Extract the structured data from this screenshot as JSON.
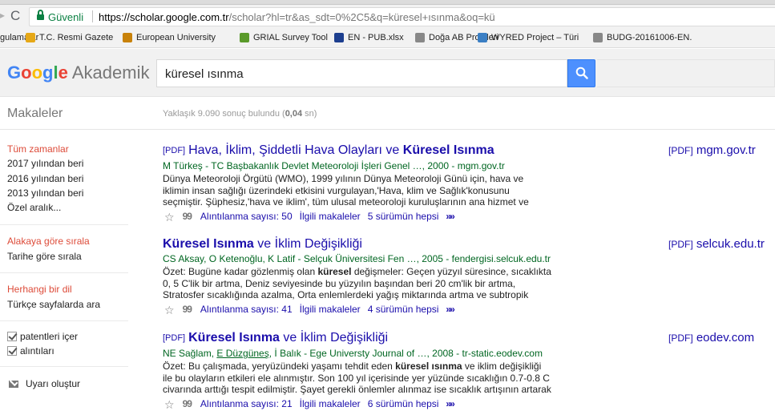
{
  "browser": {
    "reload_glyph": "C",
    "secure_label": "Güvenli",
    "url_host": "https://scholar.google.com.tr",
    "url_path": "/scholar?hl=tr&as_sdt=0%2C5&q=küresel+ısınma&oq=kü"
  },
  "bookmarks": [
    {
      "label": "gulamalar",
      "icon": "",
      "color": ""
    },
    {
      "label": "T.C. Resmi Gazete",
      "icon": "seal-icon",
      "color": "#e6a817"
    },
    {
      "label": "European University",
      "icon": "university-icon",
      "color": "#c8820a"
    },
    {
      "label": "GRIAL Survey Tool",
      "icon": "leaf-icon",
      "color": "#5a9a2a"
    },
    {
      "label": "EN - PUB.xlsx",
      "icon": "eu-flag-icon",
      "color": "#1d3f8f"
    },
    {
      "label": "Doğa AB Projeleri",
      "icon": "page-icon",
      "color": "#888888"
    },
    {
      "label": "WYRED Project – Türi",
      "icon": "bird-icon",
      "color": "#3b7fc4"
    },
    {
      "label": "BUDG-20161006-EN.",
      "icon": "page-icon",
      "color": "#888888"
    }
  ],
  "header": {
    "logo_google": "Google",
    "logo_tail": "Akademik",
    "search_value": "küresel ısınma",
    "search_icon": "search-icon"
  },
  "subheader": {
    "section": "Makaleler",
    "stats_prefix": "Yaklaşık 9.090 sonuç bulundu (",
    "stats_time": "0,04",
    "stats_suffix": " sn)"
  },
  "sidebar": {
    "time_filters": [
      "Tüm zamanlar",
      "2017 yılından beri",
      "2016 yılından beri",
      "2013 yılından beri",
      "Özel aralık..."
    ],
    "sort": [
      "Alakaya göre sırala",
      "Tarihe göre sırala"
    ],
    "lang": [
      "Herhangi bir dil",
      "Türkçe sayfalarda ara"
    ],
    "checkboxes": [
      "patentleri içer",
      "alıntıları"
    ],
    "alert": "Uyarı oluştur"
  },
  "results": [
    {
      "pdf_tag": "[PDF]",
      "title_plain": "Hava, İklim, Şiddetli Hava Olayları ve ",
      "title_bold": "Küresel Isınma",
      "title_rest": "",
      "authors": "M Türkeş - TC Başbakanlık Devlet Meteoroloji İşleri Genel …, 2000 - mgm.gov.tr",
      "snippet_html": "Dünya Meteoroloji Örgütü (WMO), 1999 yılının Dünya Meteoroloji Günü için, hava ve iklimin insan sağlığı üzerindeki etkisini vurgulayan,'Hava, klim ve Sağlık'konusunu seçmiştir. Şüphesiz,'hava ve iklim', tüm ulusal meteoroloji kuruluşlarının ana hizmet ve uygulama",
      "citations": "Alıntılanma sayısı: 50",
      "related": "İlgili makaleler",
      "versions": "5 sürümün hepsi",
      "side_tag": "[PDF]",
      "side_domain": "mgm.gov.tr"
    },
    {
      "pdf_tag": "",
      "title_plain": "",
      "title_bold": "Küresel Isınma",
      "title_rest": " ve İklim Değişikliği",
      "authors": "CS Aksay, O Ketenoğlu, K Latif - Selçuk Üniversitesi Fen …, 2005 - fendergisi.selcuk.edu.tr",
      "snippet_html": "Özet: Bugüne kadar gözlenmiş olan küresel değişmeler: Geçen yüzyıl süresince, sıcaklıkta 0, 5 C'lik bir artma, Deniz seviyesinde bu yüzyılın başından beri 20 cm'lik bir artma, Stratosfer sıcaklığında azalma, Orta enlemlerdeki yağış miktarında artma ve subtropik",
      "citations": "Alıntılanma sayısı: 41",
      "related": "İlgili makaleler",
      "versions": "4 sürümün hepsi",
      "side_tag": "[PDF]",
      "side_domain": "selcuk.edu.tr"
    },
    {
      "pdf_tag": "[PDF]",
      "title_plain": "",
      "title_bold": "Küresel Isınma",
      "title_rest": " ve İklim Değişikliği",
      "authors_pre": "NE Sağlam, ",
      "authors_u": "E Düzgüneş",
      "authors_post": ", İ Balık - Ege Universty Journal of …, 2008 - tr-static.eodev.com",
      "snippet_html": "Özet: Bu çalışmada, yeryüzündeki yaşamı tehdit eden küresel ısınma ve iklim değişikliği ile bu olayların etkileri ele alınmıştır. Son 100 yıl içerisinde yer yüzünde sıcaklığın 0.7-0.8 C civarında arttığı tespit edilmiştir. Şayet gerekli önlemler alınmaz ise sıcaklık artışının artarak",
      "citations": "Alıntılanma sayısı: 21",
      "related": "İlgili makaleler",
      "versions": "6 sürümün hepsi",
      "side_tag": "[PDF]",
      "side_domain": "eodev.com"
    }
  ],
  "icons": {
    "star": "☆",
    "cite": "99",
    "more": "»»"
  }
}
